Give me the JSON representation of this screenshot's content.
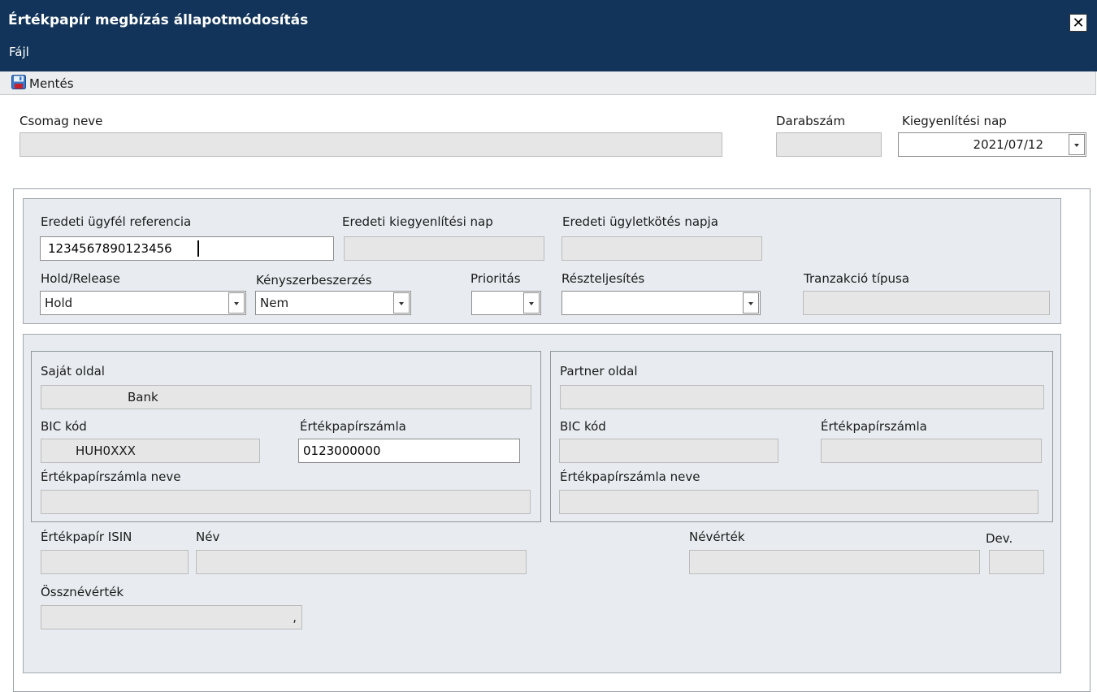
{
  "window": {
    "title": "Értékpapír megbízás állapotmódosítás",
    "close_label": "✕"
  },
  "menu": {
    "file": "Fájl"
  },
  "toolbar": {
    "save_label": "Mentés"
  },
  "header": {
    "package_name_label": "Csomag neve",
    "package_name_value": "",
    "count_label": "Darabszám",
    "count_value": "",
    "settlement_day_label": "Kiegyenlítési nap",
    "settlement_day_value": "2021/07/12"
  },
  "order": {
    "orig_client_ref_label": "Eredeti ügyfél referencia",
    "orig_client_ref_value": "1234567890123456",
    "orig_settlement_day_label": "Eredeti kiegyenlítési nap",
    "orig_settlement_day_value": "",
    "orig_trade_day_label": "Eredeti ügyletkötés napja",
    "orig_trade_day_value": "",
    "hold_release_label": "Hold/Release",
    "hold_release_value": "Hold",
    "forced_buyin_label": "Kényszerbeszerzés",
    "forced_buyin_value": "Nem",
    "priority_label": "Prioritás",
    "priority_value": "",
    "partial_label": "Részteljesítés",
    "partial_value": "",
    "transaction_type_label": "Tranzakció típusa",
    "transaction_type_value": ""
  },
  "own_side": {
    "title": "Saját oldal",
    "name_value": "Bank",
    "bic_label": "BIC kód",
    "bic_value": "HUH0XXX",
    "account_label": "Értékpapírszámla",
    "account_value": "0123000000",
    "account_name_label": "Értékpapírszámla neve",
    "account_name_value": ""
  },
  "partner_side": {
    "title": "Partner oldal",
    "name_value": "",
    "bic_label": "BIC kód",
    "bic_value": "",
    "account_label": "Értékpapírszámla",
    "account_value": "",
    "account_name_label": "Értékpapírszámla neve",
    "account_name_value": ""
  },
  "security": {
    "isin_label": "Értékpapír ISIN",
    "isin_value": "",
    "name_label": "Név",
    "name_value": "",
    "nominal_label": "Névérték",
    "nominal_value": "",
    "currency_label": "Dev.",
    "currency_value": "",
    "total_nominal_label": "Össznévérték",
    "total_nominal_value": ","
  }
}
